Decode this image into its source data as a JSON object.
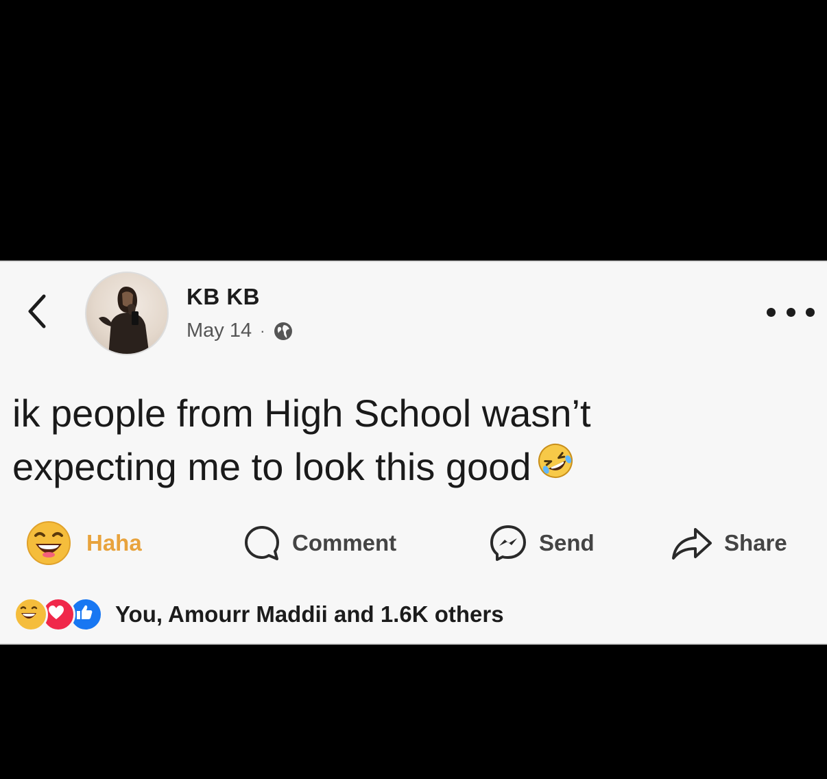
{
  "post": {
    "author_name": "KB KB",
    "date": "May 14",
    "meta_separator": "·",
    "privacy_icon": "globe-icon",
    "text_line1": "ik people from High School wasn’t",
    "text_line2": "expecting me to look this good",
    "text_emoji": "rolling-on-floor-laughing-emoji"
  },
  "actions": {
    "haha_label": "Haha",
    "comment_label": "Comment",
    "send_label": "Send",
    "share_label": "Share"
  },
  "reactions": {
    "summary_text": "You, Amourr Maddii and 1.6K others",
    "icons": [
      "haha-icon",
      "love-icon",
      "like-icon"
    ]
  },
  "colors": {
    "background": "#000000",
    "card": "#f7f7f7",
    "haha_accent": "#e8a33d",
    "like_blue": "#1877f2",
    "love_red": "#f0284a"
  }
}
